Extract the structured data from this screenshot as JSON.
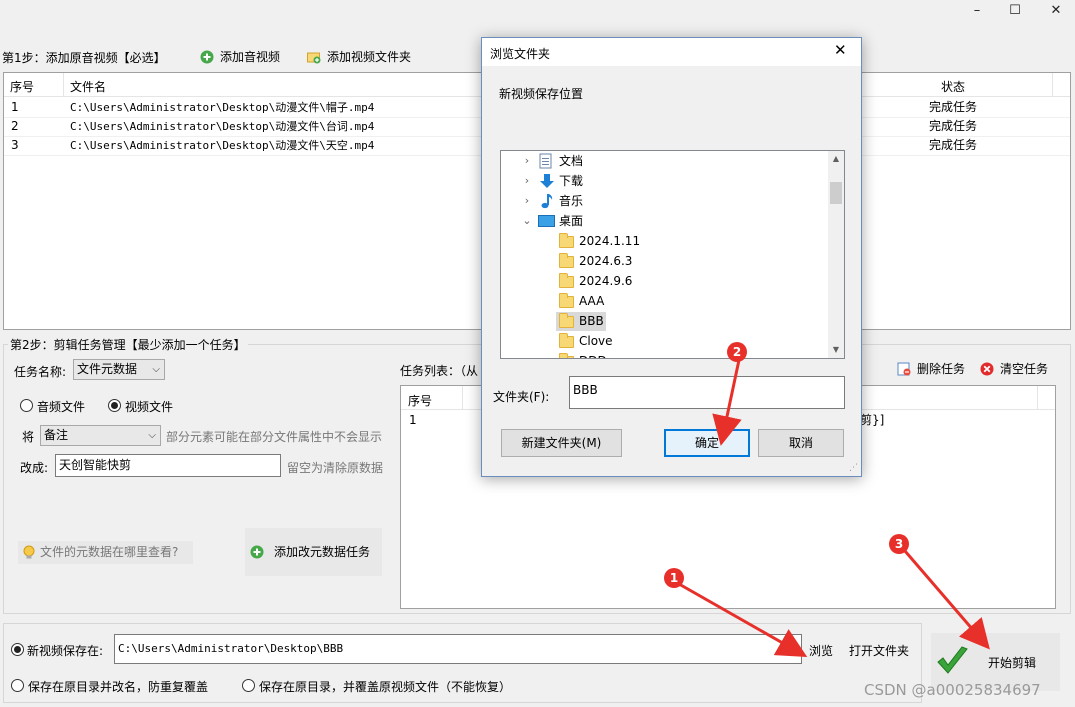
{
  "window": {
    "minimize": "–",
    "maximize": "☐",
    "close": "✕"
  },
  "step1": {
    "label": "第1步：添加原音视频【必选】",
    "add_audio_video": "添加音视频",
    "add_video_folder": "添加视频文件夹",
    "columns": [
      "序号",
      "文件名",
      "状态"
    ],
    "rows": [
      {
        "index": "1",
        "file": "C:\\Users\\Administrator\\Desktop\\动漫文件\\帽子.mp4",
        "status": "完成任务"
      },
      {
        "index": "2",
        "file": "C:\\Users\\Administrator\\Desktop\\动漫文件\\台词.mp4",
        "status": "完成任务"
      },
      {
        "index": "3",
        "file": "C:\\Users\\Administrator\\Desktop\\动漫文件\\天空.mp4",
        "status": "完成任务"
      }
    ]
  },
  "step2": {
    "label": "第2步：剪辑任务管理【最少添加一个任务】",
    "task_name_label": "任务名称:",
    "task_name_value": "文件元数据",
    "radio_audio": "音频文件",
    "radio_video": "视频文件",
    "jiang": "将",
    "field_value": "备注",
    "field_hint": "部分元素可能在部分文件属性中不会显示",
    "change_to_label": "改成:",
    "change_to_value": "天创智能快剪",
    "change_hint": "留空为清除原数据",
    "where_metadata": "文件的元数据在哪里查看?",
    "add_task": "添加改元数据任务",
    "task_list_label": "任务列表：（从",
    "delete_task": "删除任务",
    "clear_task": "清空任务",
    "task_col_index": "序号",
    "task_row_index": "1",
    "task_row_tail": "快剪}]"
  },
  "output": {
    "save_to_label": "新视频保存在:",
    "save_path": "C:\\Users\\Administrator\\Desktop\\BBB",
    "browse": "浏览",
    "open_folder": "打开文件夹",
    "option_rename": "保存在原目录并改名，防重复覆盖",
    "option_overwrite": "保存在原目录，并覆盖原视频文件（不能恢复）",
    "start": "开始剪辑"
  },
  "dialog": {
    "title": "浏览文件夹",
    "subtitle": "新视频保存位置",
    "tree": [
      {
        "label": "文档",
        "icon": "document-icon"
      },
      {
        "label": "下载",
        "icon": "download-arrow-icon"
      },
      {
        "label": "音乐",
        "icon": "music-note-icon"
      },
      {
        "label": "桌面",
        "icon": "desktop-icon"
      },
      {
        "label": "2024.1.11",
        "icon": "folder-icon"
      },
      {
        "label": "2024.6.3",
        "icon": "folder-icon"
      },
      {
        "label": "2024.9.6",
        "icon": "folder-icon"
      },
      {
        "label": "AAA",
        "icon": "folder-icon"
      },
      {
        "label": "BBB",
        "icon": "folder-icon"
      },
      {
        "label": "Clove",
        "icon": "folder-icon"
      },
      {
        "label": "DDD",
        "icon": "folder-icon"
      }
    ],
    "folder_label": "文件夹(F):",
    "folder_value": "BBB",
    "new_folder": "新建文件夹(M)",
    "ok": "确定",
    "cancel": "取消"
  },
  "annotations": [
    "1",
    "2",
    "3"
  ],
  "watermark": "CSDN @a00025834697",
  "colors": {
    "selection": "#cce8ff",
    "focus_border": "#0078d7",
    "badge": "#e8302a"
  }
}
